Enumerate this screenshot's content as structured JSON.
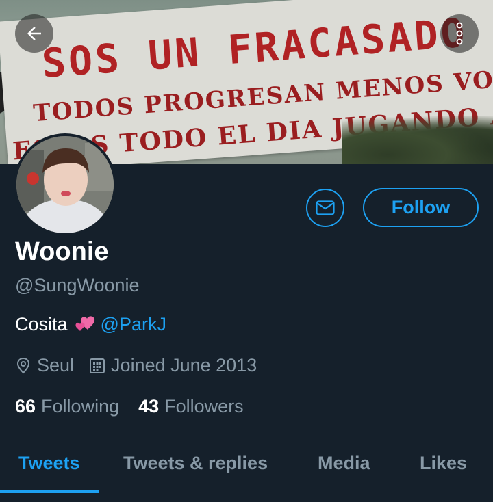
{
  "banner": {
    "sign_line1": "Sos un fracasado",
    "sign_line2": "Todos progresan menos vos",
    "sign_line3": "Estas todo el dia jugando al lol"
  },
  "header": {
    "back_icon": "arrow-left-icon",
    "more_icon": "more-vertical-icon"
  },
  "profile": {
    "name": "Woonie",
    "handle": "@SungWoonie",
    "bio_text": "Cosita",
    "bio_emoji": "two-hearts-icon",
    "bio_mention": "@ParkJ",
    "location": "Seul",
    "joined": "Joined June 2013",
    "following_count": "66",
    "following_label": "Following",
    "followers_count": "43",
    "followers_label": "Followers"
  },
  "actions": {
    "message_icon": "envelope-icon",
    "follow_label": "Follow"
  },
  "tabs": [
    {
      "label": "Tweets",
      "active": true
    },
    {
      "label": "Tweets & replies",
      "active": false
    },
    {
      "label": "Media",
      "active": false
    },
    {
      "label": "Likes",
      "active": false
    }
  ],
  "colors": {
    "background": "#15202b",
    "accent": "#1da1f2",
    "secondary_text": "#8899a6",
    "sign_text": "#a31f21"
  }
}
